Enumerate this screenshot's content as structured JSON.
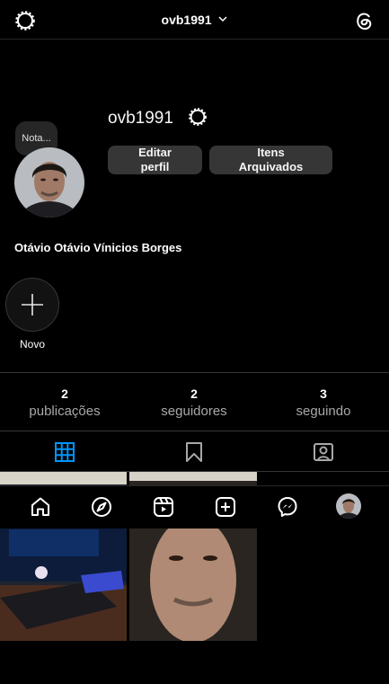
{
  "header": {
    "username": "ovb1991",
    "settings_icon": "gear-icon",
    "threads_icon": "threads-icon",
    "chevron_icon": "chevron-down-icon"
  },
  "profile": {
    "username": "ovb1991",
    "note_label": "Nota...",
    "full_name": "Otávio Otávio Vínicios Borges",
    "edit_button": "Editar perfil",
    "archive_button": "Itens Arquivados",
    "new_highlight_label": "Novo"
  },
  "stats": [
    {
      "count": "2",
      "label": "publicações"
    },
    {
      "count": "2",
      "label": "seguidores"
    },
    {
      "count": "3",
      "label": "seguindo"
    }
  ],
  "tabs": [
    "grid-icon",
    "saved-icon",
    "tagged-icon"
  ],
  "bottom_nav": [
    "home-icon",
    "explore-icon",
    "reels-icon",
    "create-icon",
    "messenger-icon",
    "profile-avatar"
  ],
  "colors": {
    "background": "#000000",
    "button": "#363636",
    "muted_text": "#a8a8a8",
    "active_tab": "#0095f6"
  }
}
